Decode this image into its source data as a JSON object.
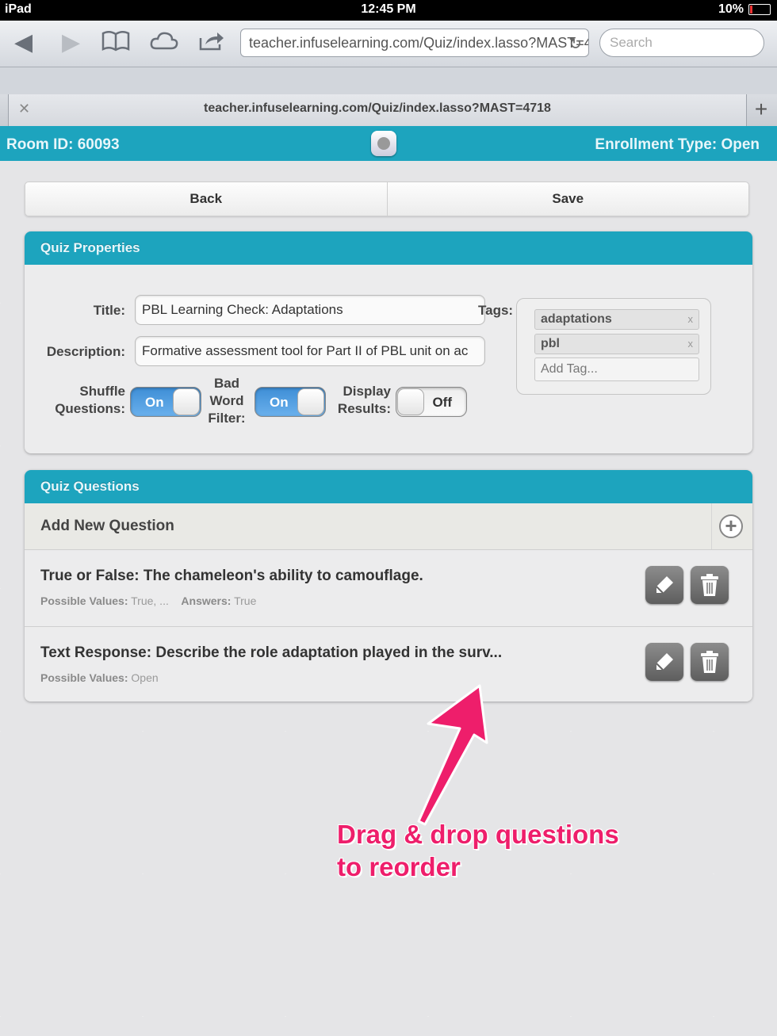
{
  "status_bar": {
    "device": "iPad",
    "time": "12:45 PM",
    "battery": "10%"
  },
  "browser": {
    "url": "teacher.infuselearning.com/Quiz/index.lasso?MAST=4718",
    "search_placeholder": "Search",
    "tab_title": "teacher.infuselearning.com/Quiz/index.lasso?MAST=4718"
  },
  "app_header": {
    "room_id": "Room ID: 60093",
    "enrollment": "Enrollment Type: Open"
  },
  "actions": {
    "back_label": "Back",
    "save_label": "Save"
  },
  "quiz_properties": {
    "heading": "Quiz Properties",
    "title_label": "Title:",
    "title_value": "PBL Learning Check: Adaptations",
    "description_label": "Description:",
    "description_value": "Formative assessment tool for Part II of PBL unit on ac",
    "shuffle_label_1": "Shuffle",
    "shuffle_label_2": "Questions:",
    "shuffle_state": "On",
    "badword_label_1": "Bad",
    "badword_label_2": "Word",
    "badword_label_3": "Filter:",
    "badword_state": "On",
    "display_label_1": "Display",
    "display_label_2": "Results:",
    "display_state": "Off",
    "tags_label": "Tags:",
    "tags": [
      "adaptations",
      "pbl"
    ],
    "add_tag_placeholder": "Add Tag..."
  },
  "quiz_questions": {
    "heading": "Quiz Questions",
    "add_new_label": "Add New Question",
    "questions": [
      {
        "text": "True or False: The chameleon's ability to camouflage.",
        "possible_label": "Possible Values:",
        "possible_value": "True, ...",
        "answers_label": "Answers:",
        "answers_value": "True"
      },
      {
        "text": "Text Response: Describe the role adaptation played in the surv...",
        "possible_label": "Possible Values:",
        "possible_value": "Open"
      }
    ]
  },
  "annotation": {
    "line1": "Drag & drop questions",
    "line2": "to reorder",
    "color": "#ee1e6b"
  },
  "colors": {
    "accent": "#1da4be",
    "toggle_on": "#3e8ed6"
  }
}
